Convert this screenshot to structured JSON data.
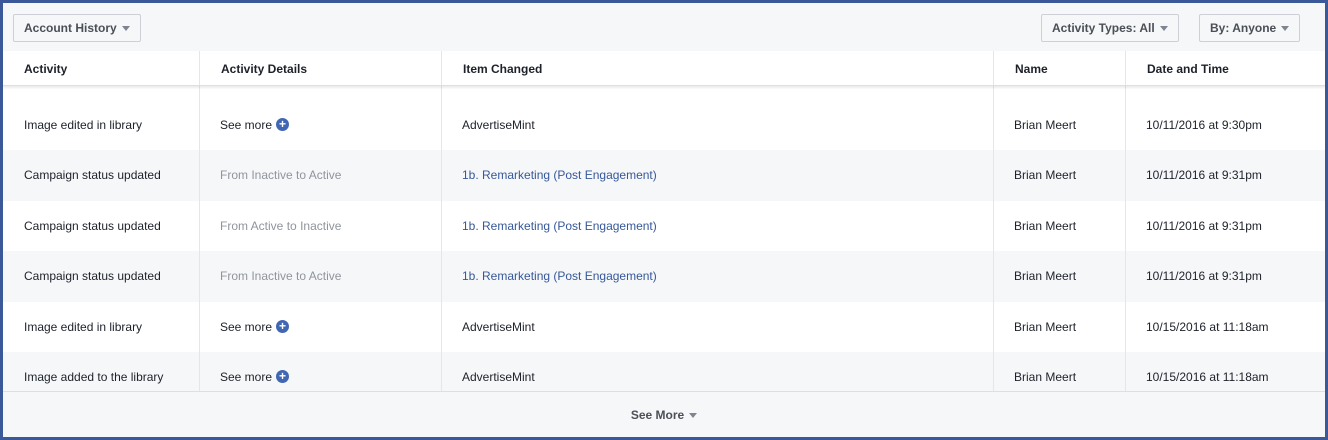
{
  "toolbar": {
    "account_history": "Account History",
    "activity_types": "Activity Types: All",
    "by_anyone": "By: Anyone"
  },
  "columns": [
    "Activity",
    "Activity Details",
    "Item Changed",
    "Name",
    "Date and Time"
  ],
  "rows": [
    {
      "activity": "Image edited in library",
      "details": {
        "type": "see_more",
        "label": "See more"
      },
      "item": "AdvertiseMint",
      "item_link": false,
      "name": "Brian Meert",
      "datetime": "10/11/2016 at 9:30pm"
    },
    {
      "activity": "Campaign status updated",
      "details": {
        "type": "status",
        "from_word": "From",
        "from": "Inactive",
        "to_word": "to",
        "to": "Active"
      },
      "item": "1b. Remarketing (Post Engagement)",
      "item_link": true,
      "name": "Brian Meert",
      "datetime": "10/11/2016 at 9:31pm"
    },
    {
      "activity": "Campaign status updated",
      "details": {
        "type": "status",
        "from_word": "From",
        "from": "Active",
        "to_word": "to",
        "to": "Inactive"
      },
      "item": "1b. Remarketing (Post Engagement)",
      "item_link": true,
      "name": "Brian Meert",
      "datetime": "10/11/2016 at 9:31pm"
    },
    {
      "activity": "Campaign status updated",
      "details": {
        "type": "status",
        "from_word": "From",
        "from": "Inactive",
        "to_word": "to",
        "to": "Active"
      },
      "item": "1b. Remarketing (Post Engagement)",
      "item_link": true,
      "name": "Brian Meert",
      "datetime": "10/11/2016 at 9:31pm"
    },
    {
      "activity": "Image edited in library",
      "details": {
        "type": "see_more",
        "label": "See more"
      },
      "item": "AdvertiseMint",
      "item_link": false,
      "name": "Brian Meert",
      "datetime": "10/15/2016 at 11:18am"
    },
    {
      "activity": "Image added to the library",
      "details": {
        "type": "see_more",
        "label": "See more"
      },
      "item": "AdvertiseMint",
      "item_link": false,
      "name": "Brian Meert",
      "datetime": "10/15/2016 at 11:18am"
    }
  ],
  "footer": {
    "see_more": "See More"
  },
  "icons": {
    "dropdown": "caret-down-icon",
    "expand": "plus-circle-icon"
  },
  "colors": {
    "border": "#3b5998",
    "link": "#365899",
    "accent": "#4267b2",
    "muted": "#90949c"
  }
}
